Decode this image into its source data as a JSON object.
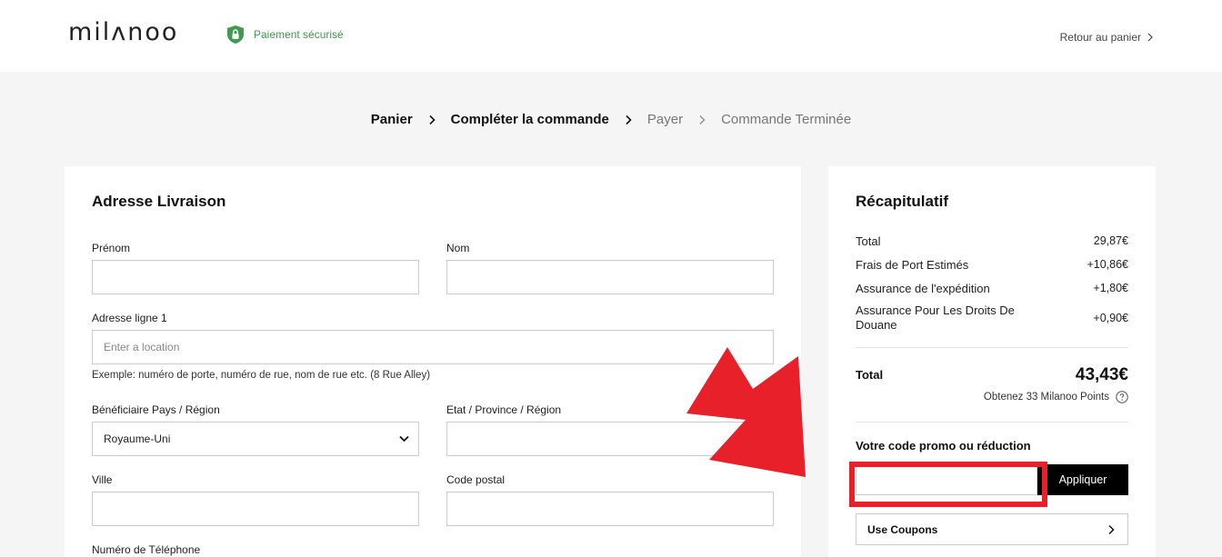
{
  "header": {
    "logo": "milʌnoo",
    "secure_label": "Paiement sécurisé",
    "back_label": "Retour au panier"
  },
  "steps": [
    {
      "label": "Panier",
      "state": "done"
    },
    {
      "label": "Compléter la commande",
      "state": "current"
    },
    {
      "label": "Payer",
      "state": "pending"
    },
    {
      "label": "Commande Terminée",
      "state": "pending"
    }
  ],
  "shipping": {
    "title": "Adresse Livraison",
    "first_name_label": "Prénom",
    "last_name_label": "Nom",
    "address_label": "Adresse ligne 1",
    "address_placeholder": "Enter a location",
    "address_hint": "Exemple: numéro de porte, numéro de rue, nom de rue etc. (8 Rue Alley)",
    "country_label": "Bénéficiaire Pays / Région",
    "country_value": "Royaume-Uni",
    "state_label": "Etat / Province / Région",
    "city_label": "Ville",
    "zip_label": "Code postal",
    "phone_label": "Numéro de Téléphone"
  },
  "summary": {
    "title": "Récapitulatif",
    "rows": [
      {
        "label": "Total",
        "value": "29,87€"
      },
      {
        "label": "Frais de Port Estimés",
        "value": "+10,86€"
      },
      {
        "label": "Assurance de l'expédition",
        "value": "+1,80€"
      },
      {
        "label": "Assurance Pour Les Droits De Douane",
        "value": "+0,90€"
      }
    ],
    "total_label": "Total",
    "total_value": "43,43€",
    "points_text": "Obtenez 33 Milanoo Points",
    "promo_title": "Votre code promo ou réduction",
    "apply_label": "Appliquer",
    "coupons_label": "Use Coupons"
  },
  "colors": {
    "accent_green": "#3f9b4d",
    "annotation_red": "#e8202a",
    "button_black": "#000000"
  }
}
